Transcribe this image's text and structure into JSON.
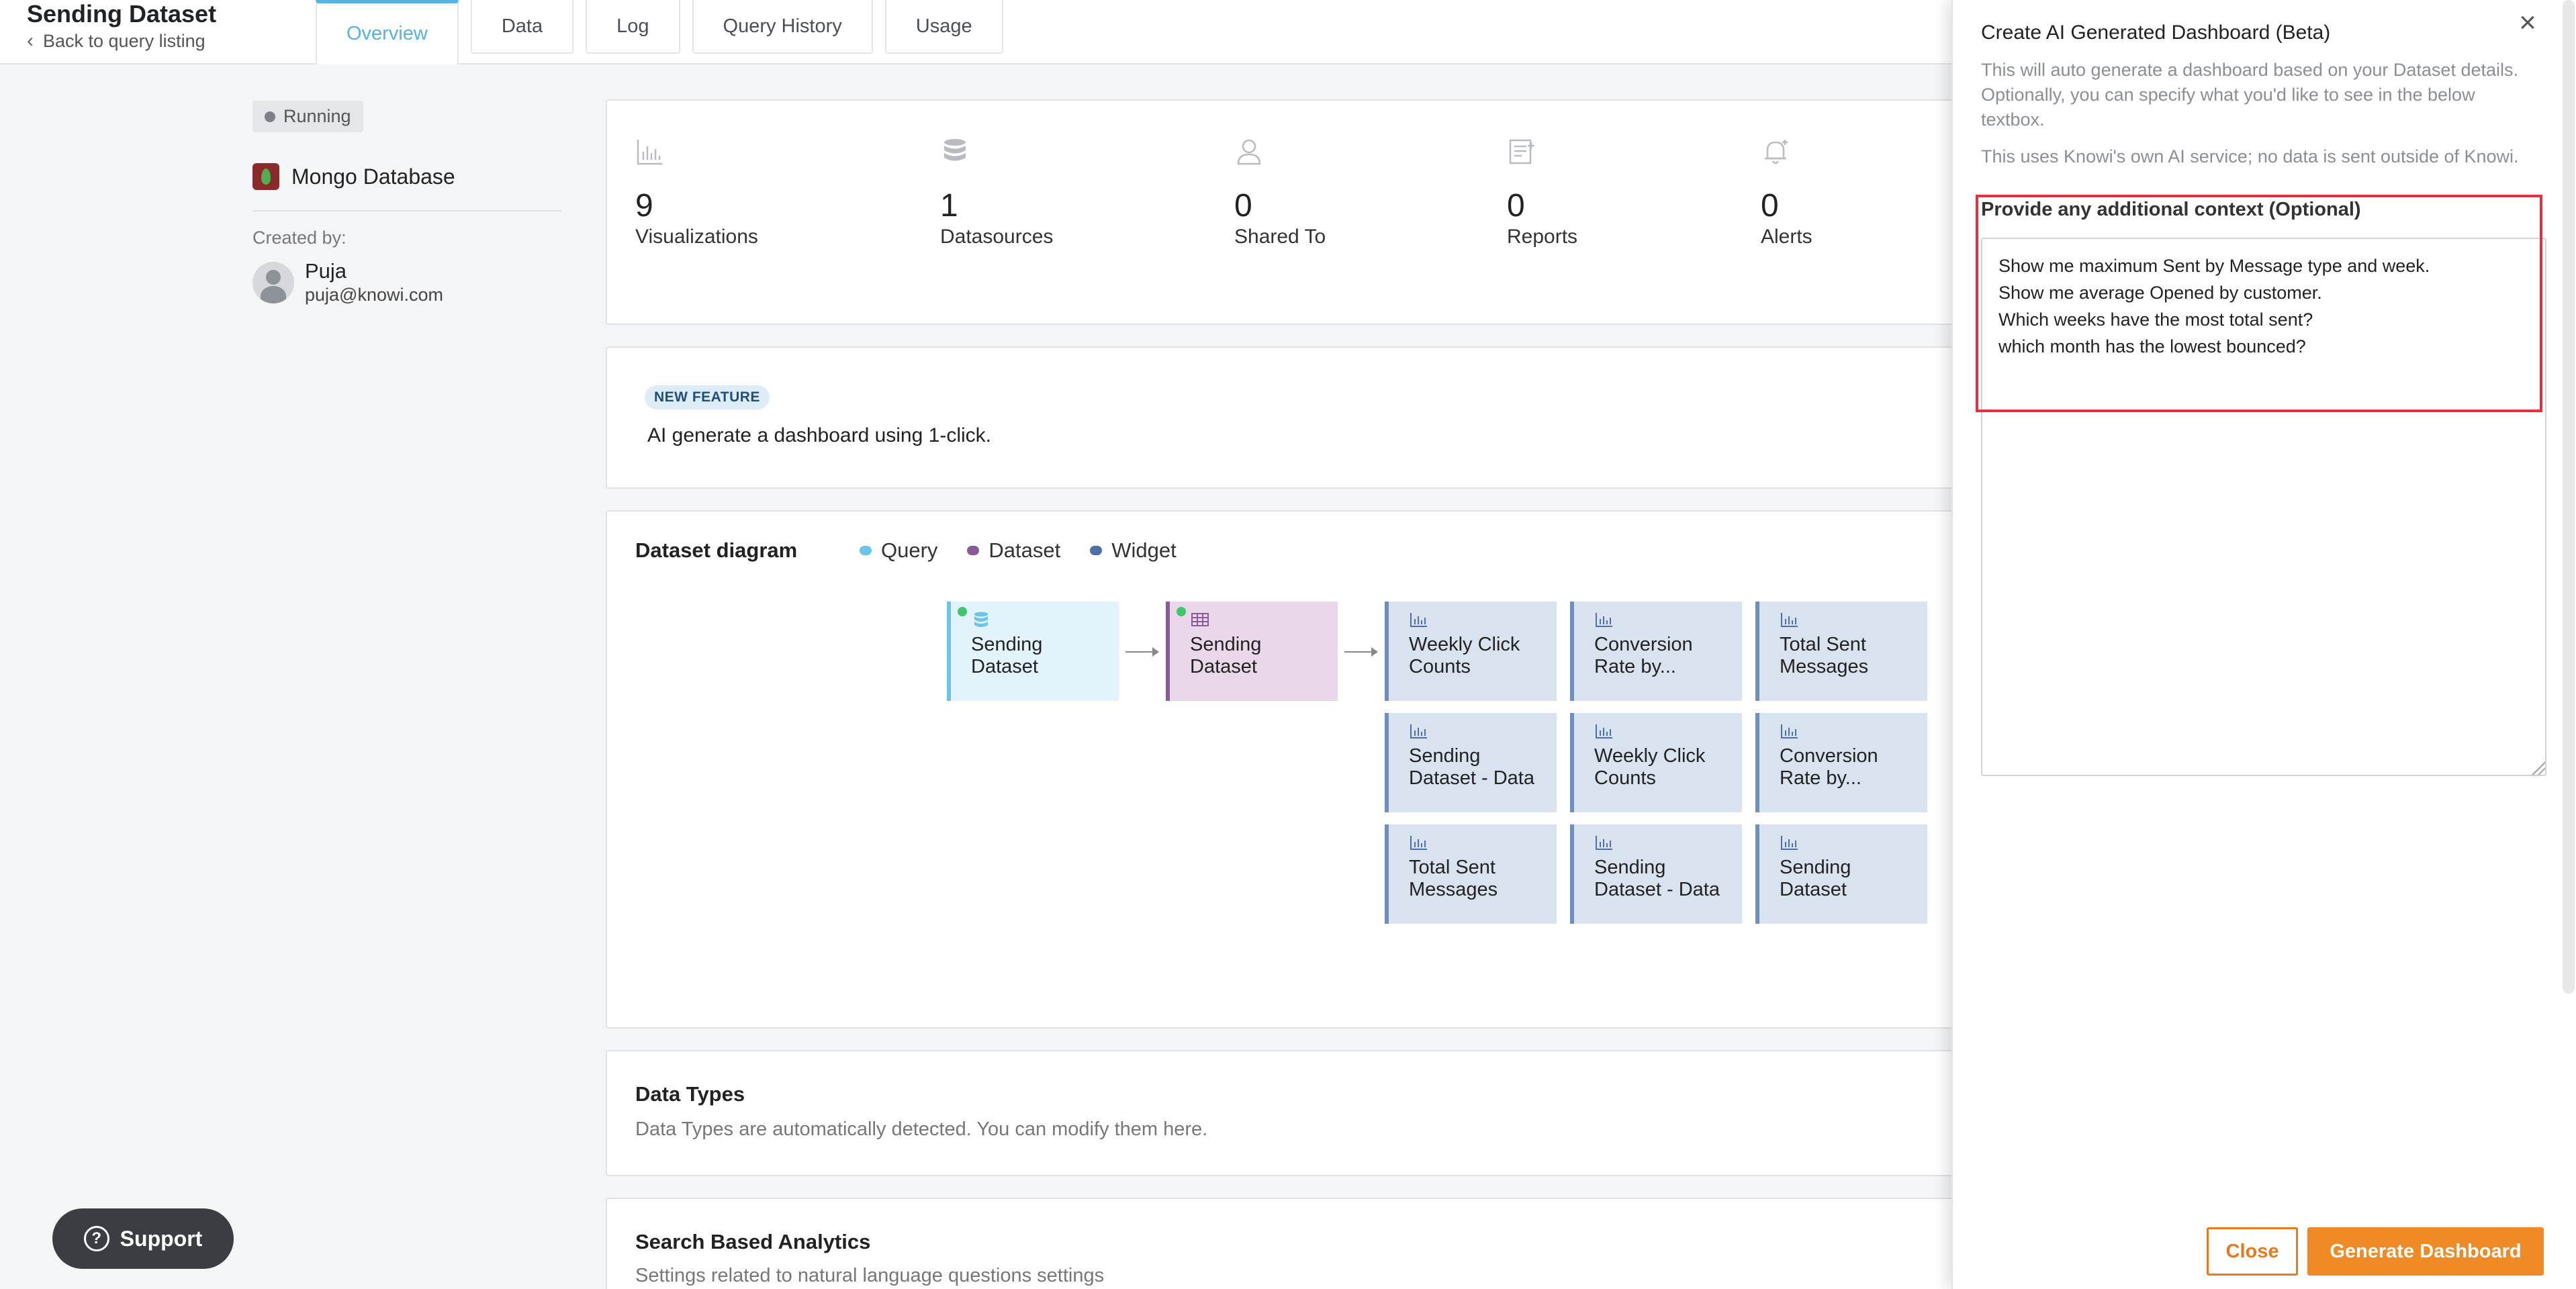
{
  "header": {
    "title": "Sending Dataset",
    "back_link": "Back to query listing",
    "tabs": [
      {
        "label": "Overview",
        "active": true
      },
      {
        "label": "Data",
        "active": false
      },
      {
        "label": "Log",
        "active": false
      },
      {
        "label": "Query History",
        "active": false
      },
      {
        "label": "Usage",
        "active": false
      }
    ]
  },
  "sidebar": {
    "status": "Running",
    "database": "Mongo Database",
    "created_by_label": "Created by:",
    "creator_name": "Puja",
    "creator_email": "puja@knowi.com"
  },
  "stats": [
    {
      "value": "9",
      "label": "Visualizations",
      "icon": "bar-chart-icon"
    },
    {
      "value": "1",
      "label": "Datasources",
      "icon": "database-icon"
    },
    {
      "value": "0",
      "label": "Shared To",
      "icon": "user-icon"
    },
    {
      "value": "0",
      "label": "Reports",
      "icon": "report-icon"
    },
    {
      "value": "0",
      "label": "Alerts",
      "icon": "bell-icon"
    }
  ],
  "feature": {
    "badge": "NEW FEATURE",
    "text": "AI generate a dashboard using 1-click."
  },
  "diagram": {
    "title": "Dataset diagram",
    "legend": [
      {
        "label": "Query",
        "color": "#6bc4ea"
      },
      {
        "label": "Dataset",
        "color": "#8a5a99"
      },
      {
        "label": "Widget",
        "color": "#4e6fa8"
      }
    ],
    "query_node": "Sending Dataset",
    "dataset_node": "Sending Dataset",
    "widgets": [
      "Weekly Click Counts",
      "Conversion Rate by...",
      "Total Sent Messages",
      "Sending Dataset - Data",
      "Weekly Click Counts",
      "Conversion Rate by...",
      "Total Sent Messages",
      "Sending Dataset - Data",
      "Sending Dataset"
    ]
  },
  "data_types": {
    "title": "Data Types",
    "subtitle": "Data Types are automatically detected. You can modify them here."
  },
  "search_analytics": {
    "title": "Search Based Analytics",
    "subtitle": "Settings related to natural language questions settings"
  },
  "support": {
    "label": "Support"
  },
  "panel": {
    "title": "Create AI Generated Dashboard (Beta)",
    "description": "This will auto generate a dashboard based on your Dataset details. Optionally, you can specify what you'd like to see in the below textbox.",
    "note": "This uses Knowi's own AI service; no data is sent outside of Knowi.",
    "context_label": "Provide any additional context (Optional)",
    "context_value": "Show me maximum Sent by Message type and week.\nShow me average Opened by customer.\nWhich weeks have the most total sent?\nwhich month has the lowest bounced?",
    "close_button": "Close",
    "generate_button": "Generate Dashboard"
  },
  "colors": {
    "accent": "#55b3e4",
    "primary_action": "#ef8a24",
    "highlight": "#e6303e"
  }
}
